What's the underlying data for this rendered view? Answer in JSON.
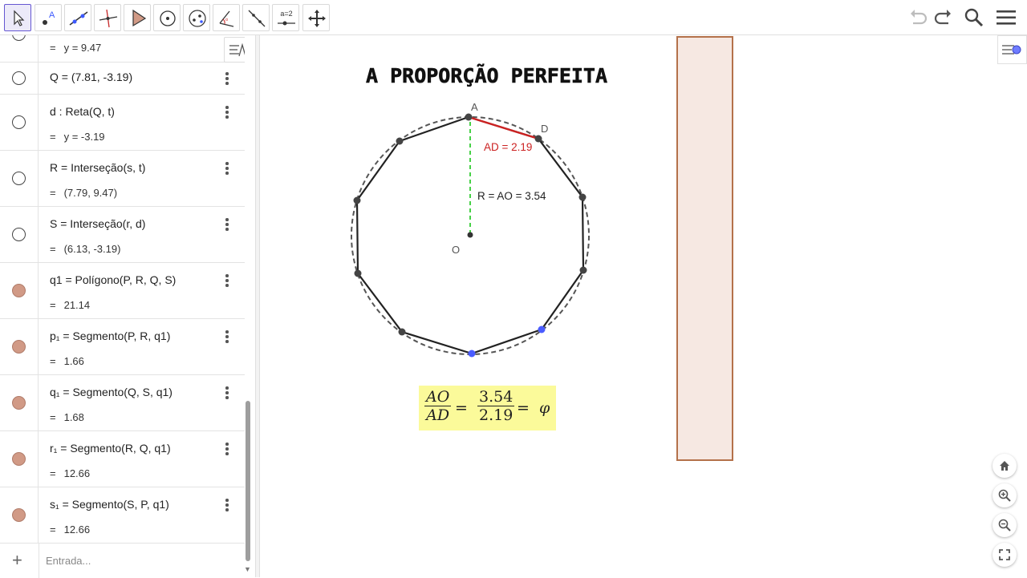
{
  "toolbar": {
    "tools": [
      {
        "name": "move-tool",
        "icon": "cursor-icon"
      },
      {
        "name": "point-tool",
        "icon": "point-icon"
      },
      {
        "name": "line-tool",
        "icon": "line-icon"
      },
      {
        "name": "perpendicular-tool",
        "icon": "perpendicular-icon"
      },
      {
        "name": "polygon-tool",
        "icon": "polygon-icon"
      },
      {
        "name": "circle-tool",
        "icon": "circle-icon"
      },
      {
        "name": "conic-tool",
        "icon": "ellipse-icon"
      },
      {
        "name": "angle-tool",
        "icon": "angle-icon"
      },
      {
        "name": "reflect-tool",
        "icon": "reflect-icon"
      },
      {
        "name": "slider-tool",
        "label": "a=2"
      },
      {
        "name": "move-graphics-tool",
        "icon": "move-arrows-icon"
      }
    ],
    "right_icons": [
      "undo-icon",
      "redo-icon",
      "search-icon",
      "menu-icon"
    ]
  },
  "algebra": {
    "rows": [
      {
        "def": "",
        "value": "y = 9.47",
        "filled": false
      },
      {
        "def": "Q = (7.81, -3.19)",
        "value": "",
        "filled": false
      },
      {
        "def": "d : Reta(Q, t)",
        "value": "y = -3.19",
        "filled": false
      },
      {
        "def": "R = Interseção(s, t)",
        "value": "(7.79, 9.47)",
        "filled": false
      },
      {
        "def": "S = Interseção(r, d)",
        "value": "(6.13, -3.19)",
        "filled": false
      },
      {
        "def": "q1 = Polígono(P, R, Q, S)",
        "value": "21.14",
        "filled": true
      },
      {
        "def": "p₁ = Segmento(P, R, q1)",
        "value": "1.66",
        "filled": true
      },
      {
        "def": "q₁ = Segmento(Q, S, q1)",
        "value": "1.68",
        "filled": true
      },
      {
        "def": "r₁ = Segmento(R, Q, q1)",
        "value": "12.66",
        "filled": true
      },
      {
        "def": "s₁ = Segmento(S, P, q1)",
        "value": "12.66",
        "filled": true
      }
    ],
    "eq_sign": "=",
    "input_placeholder": "Entrada..."
  },
  "graphics": {
    "title": "A PROPORÇÃO PERFEITA",
    "labels": {
      "A": "A",
      "D": "D",
      "O": "O",
      "ad": "AD = 2.19",
      "radius": "R = AO = 3.54"
    },
    "formula": {
      "num1": "AO",
      "den1": "AD",
      "num2": "3.54",
      "den2": "2.19",
      "eq": "=",
      "phi": "φ"
    },
    "colors": {
      "polygon": "#222222",
      "circle": "#555555",
      "ad_segment": "#cc2222",
      "radius_segment": "#33cc33",
      "blue_points": "#4a5cff",
      "formula_bg": "#fbfa9a",
      "golden_rect_fill": "#f6e8e2",
      "golden_rect_border": "#b4714a"
    }
  }
}
